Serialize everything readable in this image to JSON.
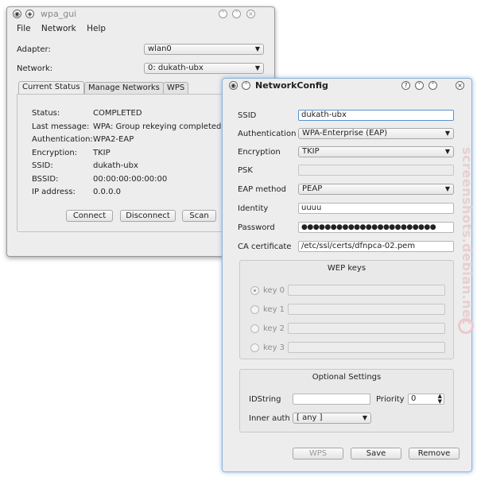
{
  "main_window": {
    "title": "wpa_gui",
    "menu": [
      "File",
      "Network",
      "Help"
    ],
    "adapter_label": "Adapter:",
    "adapter_value": "wlan0",
    "network_label": "Network:",
    "network_value": "0: dukath-ubx",
    "tabs": [
      "Current Status",
      "Manage Networks",
      "WPS"
    ],
    "status": {
      "status_label": "Status:",
      "status_value": "COMPLETED",
      "lastmsg_label": "Last message:",
      "lastmsg_value": "WPA: Group rekeying completed wit",
      "auth_label": "Authentication:",
      "auth_value": "WPA2-EAP",
      "enc_label": "Encryption:",
      "enc_value": "TKIP",
      "ssid_label": "SSID:",
      "ssid_value": "dukath-ubx",
      "bssid_label": "BSSID:",
      "bssid_value": "00:00:00:00:00:00",
      "ip_label": "IP address:",
      "ip_value": "0.0.0.0"
    },
    "buttons": {
      "connect": "Connect",
      "disconnect": "Disconnect",
      "scan": "Scan"
    }
  },
  "config_window": {
    "title": "NetworkConfig",
    "ssid_label": "SSID",
    "ssid_value": "dukath-ubx",
    "auth_label": "Authentication",
    "auth_value": "WPA-Enterprise (EAP)",
    "enc_label": "Encryption",
    "enc_value": "TKIP",
    "psk_label": "PSK",
    "eap_label": "EAP method",
    "eap_value": "PEAP",
    "identity_label": "Identity",
    "identity_value": "uuuu",
    "password_label": "Password",
    "password_value": "●●●●●●●●●●●●●●●●●●●●●●●",
    "ca_label": "CA certificate",
    "ca_value": "/etc/ssl/certs/dfnpca-02.pem",
    "wep_title": "WEP keys",
    "wep_keys": [
      "key 0",
      "key 1",
      "key 2",
      "key 3"
    ],
    "optional_title": "Optional Settings",
    "idstring_label": "IDString",
    "priority_label": "Priority",
    "priority_value": "0",
    "inner_auth_label": "Inner auth",
    "inner_auth_value": "[ any ]",
    "buttons": {
      "wps": "WPS",
      "save": "Save",
      "remove": "Remove"
    }
  },
  "watermark": "screenshots.debian.net"
}
